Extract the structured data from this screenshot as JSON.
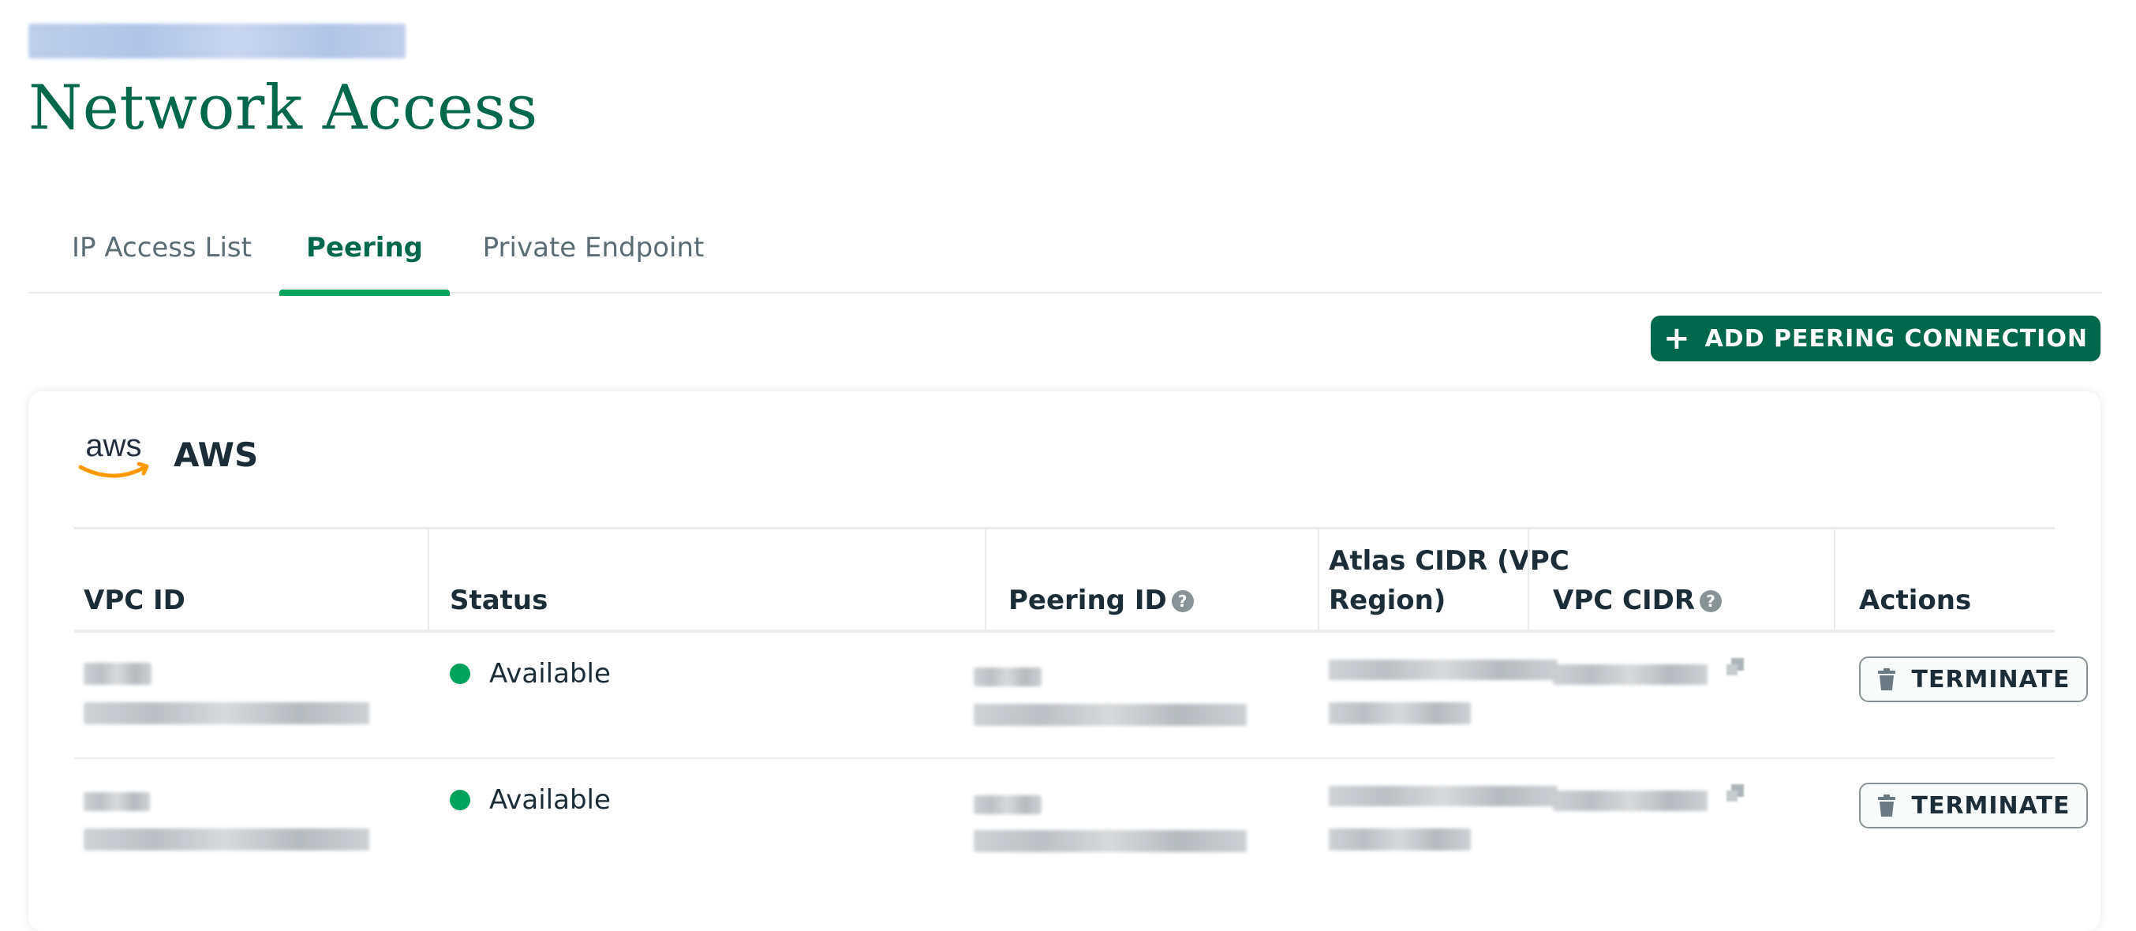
{
  "page": {
    "title": "Network Access"
  },
  "tabs": [
    {
      "label": "IP Access List",
      "active": false
    },
    {
      "label": "Peering",
      "active": true
    },
    {
      "label": "Private Endpoint",
      "active": false
    }
  ],
  "toolbar": {
    "add_peering_label": "ADD PEERING CONNECTION",
    "add_icon": "plus-icon"
  },
  "provider": {
    "name": "AWS",
    "logo_text": "aws"
  },
  "table": {
    "headers": {
      "vpc_id": "VPC ID",
      "status": "Status",
      "peering_id": "Peering ID",
      "atlas_cidr_line1": "Atlas CIDR (VPC",
      "atlas_cidr_line2": "Region)",
      "vpc_cidr": "VPC CIDR",
      "actions": "Actions"
    },
    "rows": [
      {
        "status": "Available",
        "action_label": "TERMINATE"
      },
      {
        "status": "Available",
        "action_label": "TERMINATE"
      }
    ]
  },
  "colors": {
    "brand_green": "#00684a",
    "status_available": "#00a35c"
  }
}
